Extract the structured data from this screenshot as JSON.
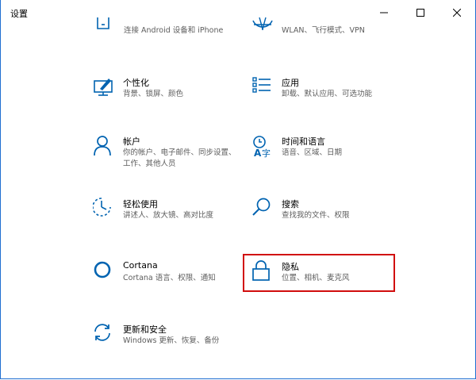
{
  "window": {
    "title": "设置"
  },
  "items": [
    {
      "id": "phone",
      "title": "",
      "desc": "连接 Android 设备和 iPhone",
      "icon": "phone-icon"
    },
    {
      "id": "network",
      "title": "",
      "desc": "WLAN、飞行模式、VPN",
      "icon": "globe-icon"
    },
    {
      "id": "personalization",
      "title": "个性化",
      "desc": "背景、锁屏、颜色",
      "icon": "paint-icon"
    },
    {
      "id": "apps",
      "title": "应用",
      "desc": "卸载、默认应用、可选功能",
      "icon": "apps-list-icon"
    },
    {
      "id": "accounts",
      "title": "帐户",
      "desc": "你的帐户、电子邮件、同步设置、工作、其他人员",
      "icon": "person-icon"
    },
    {
      "id": "time-language",
      "title": "时间和语言",
      "desc": "语音、区域、日期",
      "icon": "time-language-icon"
    },
    {
      "id": "ease-of-access",
      "title": "轻松使用",
      "desc": "讲述人、放大镜、高对比度",
      "icon": "ease-of-access-icon"
    },
    {
      "id": "search",
      "title": "搜索",
      "desc": "查找我的文件、权限",
      "icon": "search-icon"
    },
    {
      "id": "cortana",
      "title": "Cortana",
      "desc": "Cortana 语言、权限、通知",
      "icon": "cortana-icon"
    },
    {
      "id": "privacy",
      "title": "隐私",
      "desc": "位置、相机、麦克风",
      "icon": "lock-icon"
    },
    {
      "id": "update-security",
      "title": "更新和安全",
      "desc": "Windows 更新、恢复、备份",
      "icon": "update-icon"
    }
  ],
  "accent_color": "#0063b1",
  "highlight_color": "#d10d0d"
}
